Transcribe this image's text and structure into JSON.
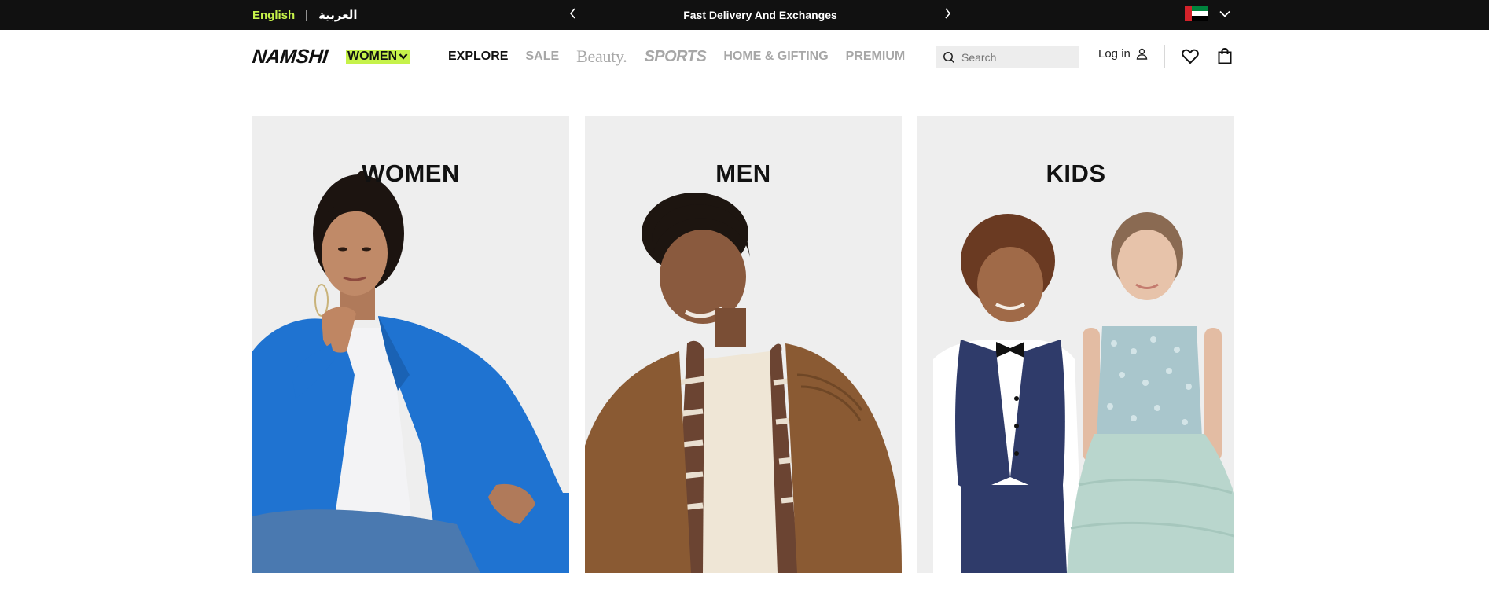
{
  "topbar": {
    "lang_english": "English",
    "lang_separator": "|",
    "lang_arabic": "العربية",
    "promo_text": "Fast Delivery And Exchanges",
    "prev_icon": "chevron-left-icon",
    "next_icon": "chevron-right-icon",
    "country_flag": "uae-flag",
    "country_icon": "chevron-down-icon"
  },
  "header": {
    "logo": "NAMSHI",
    "department": "WOMEN",
    "nav": [
      {
        "label": "EXPLORE"
      },
      {
        "label": "SALE"
      },
      {
        "label": "Beauty."
      },
      {
        "label": "SPORTS"
      },
      {
        "label": "HOME & GIFTING"
      },
      {
        "label": "PREMIUM"
      }
    ],
    "search_placeholder": "Search",
    "login_label": "Log in",
    "icons": {
      "search": "search-icon",
      "user": "user-icon",
      "wishlist": "heart-icon",
      "bag": "shopping-bag-icon"
    }
  },
  "categories": [
    {
      "title": "WOMEN"
    },
    {
      "title": "MEN"
    },
    {
      "title": "KIDS"
    }
  ],
  "colors": {
    "accent": "#c6f24a",
    "topbar_bg": "#111111",
    "card_bg": "#eeeeee",
    "nav_inactive": "#a7a7a7",
    "women_jacket": "#1f73d1",
    "men_jacket": "#8a5a33",
    "kids_vest": "#2f3b6a",
    "kids_dress": "#b9d6cd"
  }
}
